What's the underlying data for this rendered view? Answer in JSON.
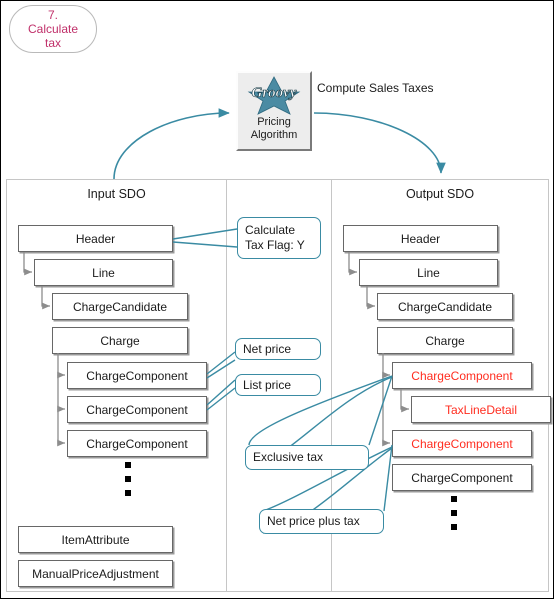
{
  "step": {
    "number": "7.",
    "label_line1": "Calculate",
    "label_line2": "tax",
    "color": "#c0306a"
  },
  "algorithm": {
    "logo_text": "Groovy",
    "label_line1": "Pricing",
    "label_line2": "Algorithm",
    "caption": "Compute Sales Taxes",
    "arrow_color": "#3a8ba3"
  },
  "panels": {
    "input": {
      "title": "Input SDO",
      "boxes": [
        {
          "label": "Header",
          "color": "black"
        },
        {
          "label": "Line",
          "color": "black"
        },
        {
          "label": "ChargeCandidate",
          "color": "black"
        },
        {
          "label": "Charge",
          "color": "black"
        },
        {
          "label": "ChargeComponent",
          "color": "black"
        },
        {
          "label": "ChargeComponent",
          "color": "black"
        },
        {
          "label": "ChargeComponent",
          "color": "black"
        },
        {
          "label": "ItemAttribute",
          "color": "black"
        },
        {
          "label": "ManualPriceAdjustment",
          "color": "black"
        }
      ]
    },
    "output": {
      "title": "Output SDO",
      "boxes": [
        {
          "label": "Header",
          "color": "black"
        },
        {
          "label": "Line",
          "color": "black"
        },
        {
          "label": "ChargeCandidate",
          "color": "black"
        },
        {
          "label": "Charge",
          "color": "black"
        },
        {
          "label": "ChargeComponent",
          "color": "red"
        },
        {
          "label": "TaxLineDetail",
          "color": "red"
        },
        {
          "label": "ChargeComponent",
          "color": "red"
        },
        {
          "label": "ChargeComponent",
          "color": "black"
        }
      ]
    }
  },
  "callouts": [
    {
      "id": "calculate-tax-flag",
      "line1": "Calculate",
      "line2": "Tax Flag: Y"
    },
    {
      "id": "net-price",
      "line1": "Net price",
      "line2": ""
    },
    {
      "id": "list-price",
      "line1": "List price",
      "line2": ""
    },
    {
      "id": "exclusive-tax",
      "line1": "Exclusive tax",
      "line2": ""
    },
    {
      "id": "net-price-plus-tax",
      "line1": "Net price plus tax",
      "line2": ""
    }
  ],
  "colors": {
    "accent_teal": "#3a8ba3",
    "box_border": "#676767",
    "red_text": "#ff2d20",
    "panel_border": "#c6c6c6"
  }
}
